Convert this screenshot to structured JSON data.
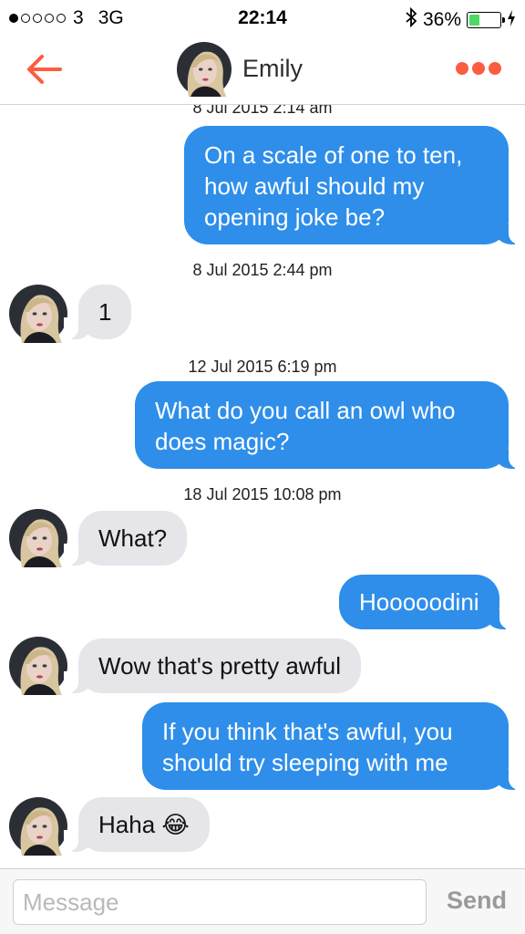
{
  "status_bar": {
    "carrier": "3",
    "network": "3G",
    "time": "22:14",
    "battery": "36%",
    "battery_level": 0.36
  },
  "header": {
    "name": "Emily",
    "accent": "#fd5c40"
  },
  "colors": {
    "outgoing": "#2e8eea",
    "incoming": "#e6e5ea"
  },
  "messages": [
    {
      "timestamp": "8 Jul 2015 2:14 am",
      "from": "me",
      "lines": [
        "On a scale of one to ten,",
        "how awful should my",
        "opening joke be?"
      ]
    },
    {
      "timestamp": "8 Jul 2015 2:44 pm",
      "from": "Emily",
      "lines": [
        "1"
      ]
    },
    {
      "timestamp": "12 Jul 2015 6:19 pm",
      "from": "me",
      "lines": [
        "What do you call an owl who",
        "does magic?"
      ]
    },
    {
      "timestamp": "18 Jul 2015 10:08 pm",
      "from": "Emily",
      "lines": [
        "What?"
      ]
    },
    {
      "from": "me",
      "lines": [
        "Hooooodini"
      ]
    },
    {
      "from": "Emily",
      "lines": [
        "Wow that's pretty awful"
      ]
    },
    {
      "from": "me",
      "lines": [
        "If you think that's awful, you",
        "should try sleeping with me"
      ]
    },
    {
      "from": "Emily",
      "lines": [
        "Haha 😂"
      ]
    }
  ],
  "composer": {
    "placeholder": "Message",
    "send_label": "Send"
  }
}
